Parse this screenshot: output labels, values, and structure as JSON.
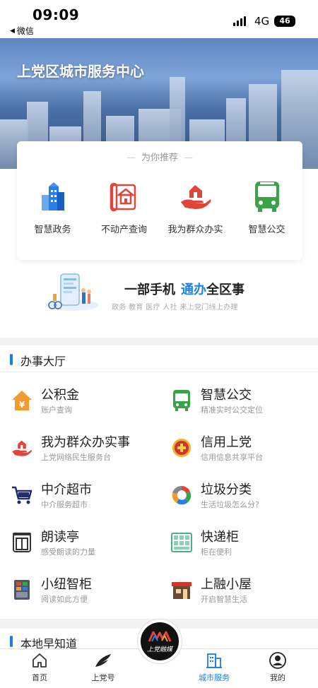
{
  "status_bar": {
    "time": "09:09",
    "back_label": "微信",
    "network": "4G",
    "battery": "46"
  },
  "hero": {
    "title": "上党区城市服务中心"
  },
  "recommend": {
    "title": "为你推荐",
    "items": [
      {
        "label": "智慧政务",
        "icon": "government-building-icon"
      },
      {
        "label": "不动产查询",
        "icon": "property-icon"
      },
      {
        "label": "我为群众办实",
        "icon": "hand-house-icon"
      },
      {
        "label": "智慧公交",
        "icon": "bus-icon"
      }
    ]
  },
  "slogan": {
    "main_prefix": "一部手机",
    "main_highlight": "通办",
    "main_suffix": "全区事",
    "sub": "政务  教育  医疗  人社  来上党门线上办理"
  },
  "hall": {
    "title": "办事大厅",
    "items": [
      {
        "name": "公积金",
        "desc": "账户查询",
        "icon": "housing-fund-icon"
      },
      {
        "name": "智慧公交",
        "desc": "精准实时公交定位",
        "icon": "bus-icon"
      },
      {
        "name": "我为群众办实事",
        "desc": "上党网络民生服务台",
        "icon": "hand-house-icon"
      },
      {
        "name": "信用上党",
        "desc": "信用信息共享平台",
        "icon": "credit-badge-icon"
      },
      {
        "name": "中介超市",
        "desc": "中介服务超市",
        "icon": "shopping-cart-icon"
      },
      {
        "name": "垃圾分类",
        "desc": "生活垃圾怎么分?",
        "icon": "recycle-icon"
      },
      {
        "name": "朗读亭",
        "desc": "感受朗读的力量",
        "icon": "reading-booth-icon"
      },
      {
        "name": "快递柜",
        "desc": "柜在便利",
        "icon": "parcel-locker-icon"
      },
      {
        "name": "小纽智柜",
        "desc": "阅读如此方便",
        "icon": "smart-cabinet-icon"
      },
      {
        "name": "上融小屋",
        "desc": "开启智慧生活",
        "icon": "shop-house-icon"
      }
    ]
  },
  "local": {
    "title": "本地早知道"
  },
  "tabbar": {
    "items": [
      {
        "label": "首页",
        "icon": "home-icon"
      },
      {
        "label": "上党号",
        "icon": "feather-icon"
      },
      {
        "label": "城市服务",
        "icon": "city-building-icon",
        "active": true
      },
      {
        "label": "我的",
        "icon": "user-icon"
      }
    ],
    "center_brand": "上党融媒"
  },
  "colors": {
    "accent": "#1a7fe0",
    "bus_green": "#3aa24a",
    "alert_red": "#e0453a",
    "orange": "#f39a2b"
  }
}
